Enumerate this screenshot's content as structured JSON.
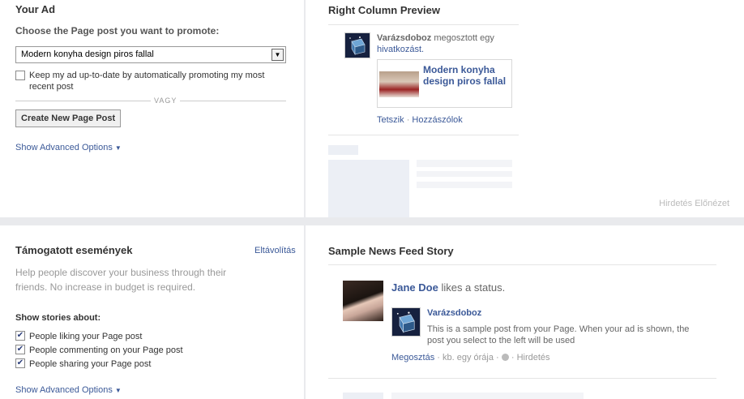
{
  "your_ad": {
    "title": "Your Ad",
    "choose_label": "Choose the Page post you want to promote:",
    "selected_post": "Modern konyha design piros fallal",
    "keep_updated_label": "Keep my ad up-to-date by automatically promoting my most recent post",
    "or_label": "VAGY",
    "create_button": "Create New Page Post",
    "advanced_label": "Show Advanced Options"
  },
  "right_column": {
    "title": "Right Column Preview",
    "page_name": "Varázsdoboz",
    "shared_text": "megosztott egy",
    "link_text": "hivatkozást.",
    "card_title": "Modern konyha design piros fallal",
    "like_label": "Tetszik",
    "comments_label": "Hozzászólok",
    "ad_preview_label": "Hirdetés Előnézet"
  },
  "sponsored": {
    "title": "Támogatott események",
    "remove_label": "Eltávolítás",
    "description": "Help people discover your business through their friends. No increase in budget is required.",
    "show_stories_label": "Show stories about:",
    "options": [
      {
        "label": "People liking your Page post",
        "checked": true
      },
      {
        "label": "People commenting on your Page post",
        "checked": true
      },
      {
        "label": "People sharing your Page post",
        "checked": true
      }
    ],
    "advanced_label": "Show Advanced Options"
  },
  "news_feed": {
    "title": "Sample News Feed Story",
    "user_name": "Jane Doe",
    "action": "likes a status.",
    "page_name": "Varázsdoboz",
    "post_text": "This is a sample post from your Page. When your ad is shown, the post you select to the left will be used",
    "share_label": "Megosztás",
    "time_label": "kb. egy órája",
    "ad_label": "Hirdetés"
  }
}
